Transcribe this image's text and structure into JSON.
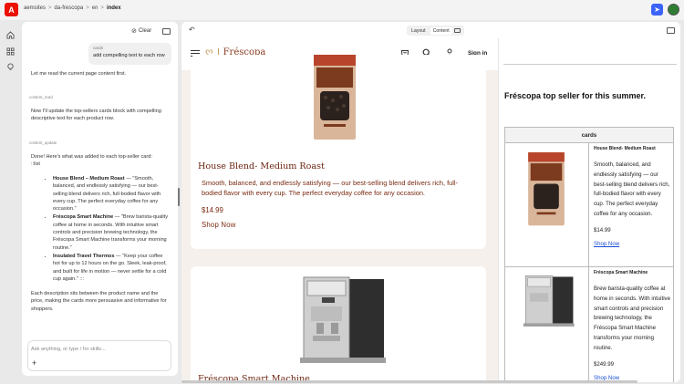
{
  "app": {
    "logo_letter": "A"
  },
  "breadcrumb": [
    "aemsites",
    "da-frescopa",
    "en",
    "index"
  ],
  "chat": {
    "clear_label": "Clear",
    "user_message": {
      "tag": "cards",
      "text": "add compelling text to each row"
    },
    "intro": "Let me read the current page content first.",
    "tool_read": "content_read",
    "plan": "Now I'll update the top-sellers cards block with compelling descriptive text for each product row.",
    "tool_update": "content_update",
    "done_line1": "Done! Here's what was added to each top-seller card:",
    "done_line2": "::list",
    "items": [
      {
        "name": "House Blend – Medium Roast",
        "text": " — \"Smooth, balanced, and endlessly satisfying — our best-selling blend delivers rich, full-bodied flavor with every cup. The perfect everyday coffee for any occasion.\""
      },
      {
        "name": "Fréscopa Smart Machine",
        "text": " — \"Brew barista-quality coffee at home in seconds. With intuitive smart controls and precision brewing technology, the Fréscopa Smart Machine transforms your morning routine.\""
      },
      {
        "name": "Insulated Travel Thermos",
        "text": " — \"Keep your coffee hot for up to 12 hours on the go. Sleek, leak-proof, and built for life in motion — never settle for a cold cup again.\" :::"
      }
    ],
    "summary": "Each description sits between the product name and the price, making the cards more persuasive and informative for shoppers.",
    "input_placeholder": "Ask anything, or type / for skills...",
    "plus": "+"
  },
  "preview_toolbar": {
    "undo": "↶",
    "layout": "Layout",
    "content": "Content"
  },
  "site": {
    "brand": "Fréscopa",
    "signin": "Sign in",
    "card1": {
      "name": "House Blend- Medium Roast",
      "desc": "Smooth, balanced, and endlessly satisfying — our best-selling blend delivers rich, full-bodied flavor with every cup. The perfect everyday coffee for any occasion.",
      "price": "$14.99",
      "link": "Shop Now"
    },
    "card2": {
      "name": "Fréscopa Smart Machine"
    }
  },
  "structure": {
    "title": "Fréscopa top seller for this summer.",
    "table_header": "cards",
    "row1": {
      "name": "House Blend- Medium Roast",
      "desc": "Smooth, balanced, and endlessly satisfying — our best-selling blend delivers rich, full-bodied flavor with every cup. The perfect everyday coffee for any occasion.",
      "price": "$14.99",
      "link": "Shop Now"
    },
    "row2": {
      "name": "Fréscopa Smart Machine",
      "desc": "Brew barista-quality coffee at home in seconds. With intuitive smart controls and precision brewing technology, the Fréscopa Smart Machine transforms your morning routine.",
      "price": "$249.99",
      "link": "Shop Now"
    }
  },
  "colors": {
    "accent": "#3b63fb",
    "adobe_red": "#eb1000",
    "brand_brown": "#7a2a10",
    "link_blue": "#1a4fd6"
  }
}
